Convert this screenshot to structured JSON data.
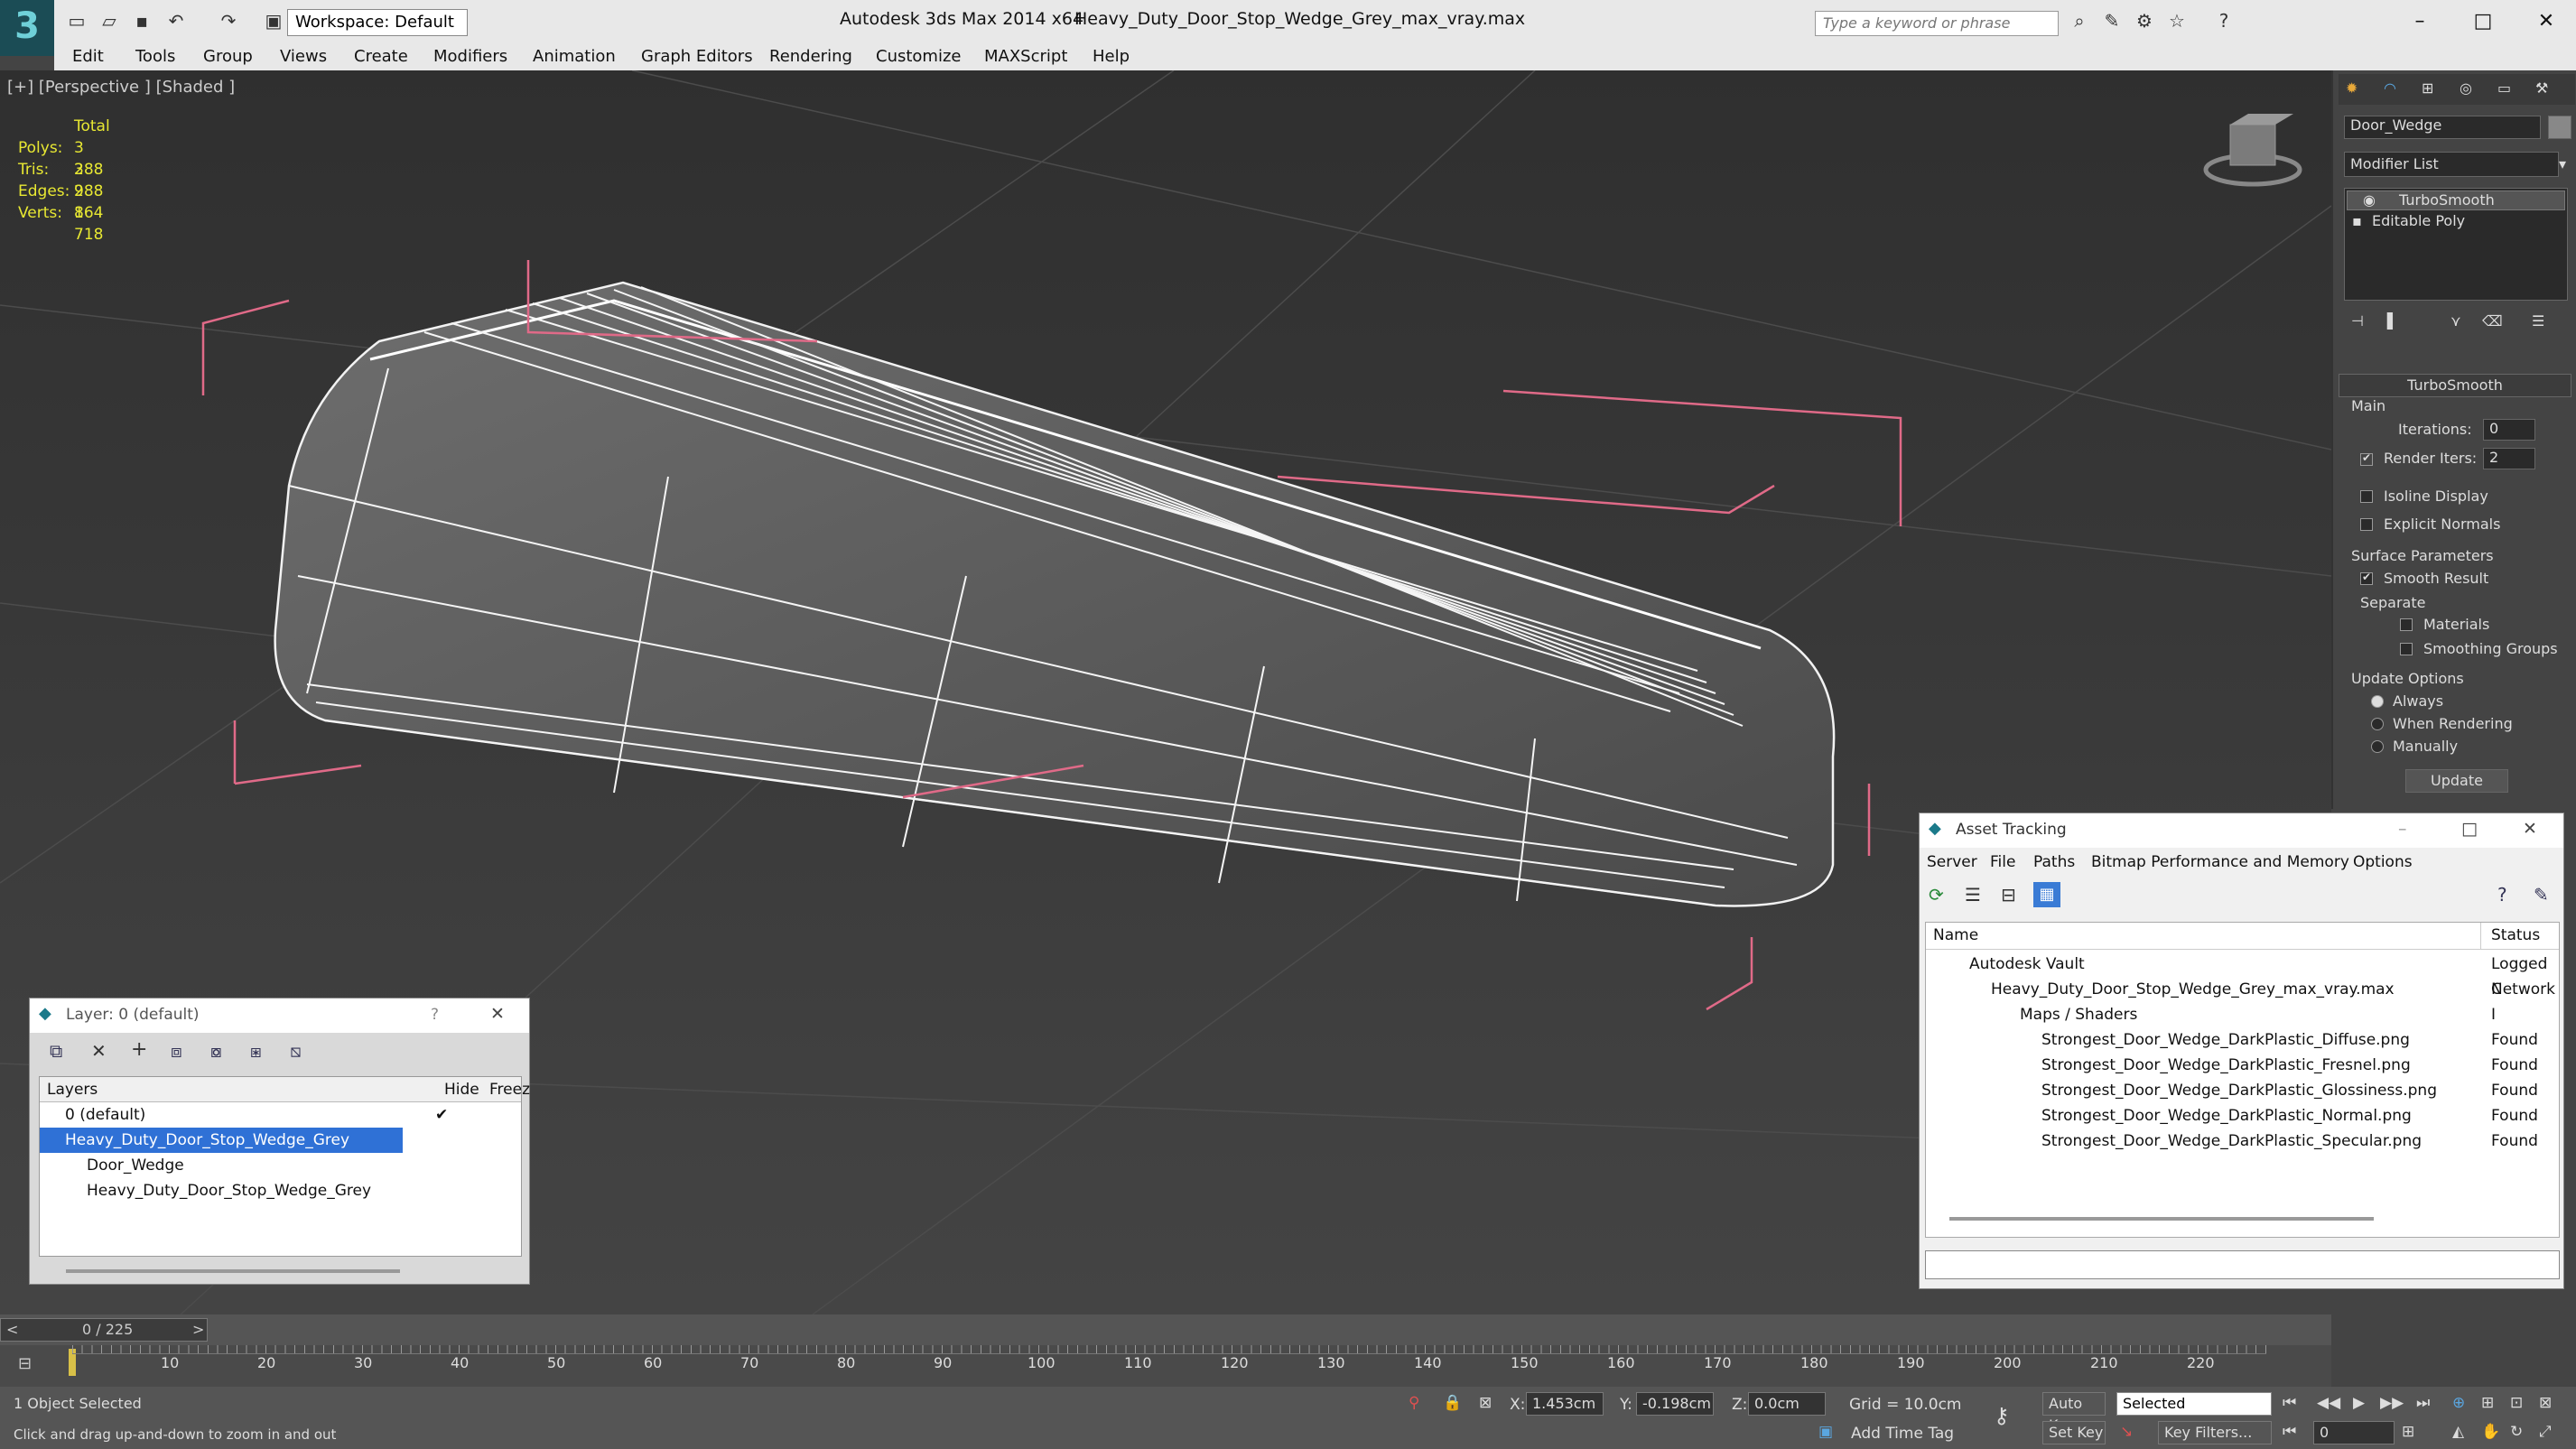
{
  "titlebar": {
    "app_title": "Autodesk 3ds Max  2014 x64",
    "file_title": "Heavy_Duty_Door_Stop_Wedge_Grey_max_vray.max",
    "workspace": "Workspace: Default",
    "search_placeholder": "Type a keyword or phrase"
  },
  "menu": [
    "Edit",
    "Tools",
    "Group",
    "Views",
    "Create",
    "Modifiers",
    "Animation",
    "Graph Editors",
    "Rendering",
    "Customize",
    "MAXScript",
    "Help"
  ],
  "viewport": {
    "label": "[+] [Perspective ] [Shaded ]",
    "stats_header": "Total",
    "stats": [
      {
        "label": "Polys:",
        "value": "3 288"
      },
      {
        "label": "Tris:",
        "value": "3 288"
      },
      {
        "label": "Edges:",
        "value": "9 864"
      },
      {
        "label": "Verts:",
        "value": "1 718"
      }
    ]
  },
  "command_panel": {
    "object_name": "Door_Wedge",
    "modifier_list": "Modifier List",
    "stack": [
      "TurboSmooth",
      "Editable Poly"
    ],
    "rollout_title": "TurboSmooth",
    "main_label": "Main",
    "iterations_label": "Iterations:",
    "iterations_value": "0",
    "render_iters_label": "Render Iters:",
    "render_iters_value": "2",
    "isoline": "Isoline Display",
    "explicit_normals": "Explicit Normals",
    "surface_params": "Surface Parameters",
    "smooth_result": "Smooth Result",
    "separate": "Separate",
    "materials": "Materials",
    "smoothing_groups": "Smoothing Groups",
    "update_options": "Update Options",
    "always": "Always",
    "when_rendering": "When Rendering",
    "manually": "Manually",
    "update_button": "Update"
  },
  "layer_window": {
    "title": "Layer: 0 (default)",
    "help": "?",
    "columns": {
      "layers": "Layers",
      "hide": "Hide",
      "freeze": "Freez"
    },
    "rows": [
      {
        "name": "0 (default)",
        "indent": 1
      },
      {
        "name": "Heavy_Duty_Door_Stop_Wedge_Grey",
        "indent": 1,
        "selected": true
      },
      {
        "name": "Door_Wedge",
        "indent": 2
      },
      {
        "name": "Heavy_Duty_Door_Stop_Wedge_Grey",
        "indent": 2
      }
    ]
  },
  "asset_window": {
    "title": "Asset Tracking",
    "menu": [
      "Server",
      "File",
      "Paths",
      "Bitmap Performance and Memory",
      "Options"
    ],
    "columns": {
      "name": "Name",
      "status": "Status"
    },
    "rows": [
      {
        "name": "Autodesk Vault",
        "status": "Logged C",
        "indent": 1
      },
      {
        "name": "Heavy_Duty_Door_Stop_Wedge_Grey_max_vray.max",
        "status": "Network I",
        "indent": 2
      },
      {
        "name": "Maps / Shaders",
        "status": "",
        "indent": 3
      },
      {
        "name": "Strongest_Door_Wedge_DarkPlastic_Diffuse.png",
        "status": "Found",
        "indent": 4
      },
      {
        "name": "Strongest_Door_Wedge_DarkPlastic_Fresnel.png",
        "status": "Found",
        "indent": 4
      },
      {
        "name": "Strongest_Door_Wedge_DarkPlastic_Glossiness.png",
        "status": "Found",
        "indent": 4
      },
      {
        "name": "Strongest_Door_Wedge_DarkPlastic_Normal.png",
        "status": "Found",
        "indent": 4
      },
      {
        "name": "Strongest_Door_Wedge_DarkPlastic_Specular.png",
        "status": "Found",
        "indent": 4
      }
    ]
  },
  "timeline": {
    "frame": "0 / 225",
    "ticks": [
      "10",
      "20",
      "30",
      "40",
      "50",
      "60",
      "70",
      "80",
      "90",
      "100",
      "110",
      "120",
      "130",
      "140",
      "150",
      "160",
      "170",
      "180",
      "190",
      "200",
      "210",
      "220"
    ]
  },
  "status": {
    "selected": "1 Object Selected",
    "prompt": "Click and drag up-and-down to zoom in and out",
    "x_label": "X:",
    "x_value": "1.453cm",
    "y_label": "Y:",
    "y_value": "-0.198cm",
    "z_label": "Z:",
    "z_value": "0.0cm",
    "grid": "Grid = 10.0cm",
    "auto_key": "Auto Key",
    "selected_dropdown": "Selected",
    "set_key": "Set Key",
    "key_filters": "Key Filters...",
    "add_time_tag": "Add Time Tag",
    "frame_field": "0"
  }
}
